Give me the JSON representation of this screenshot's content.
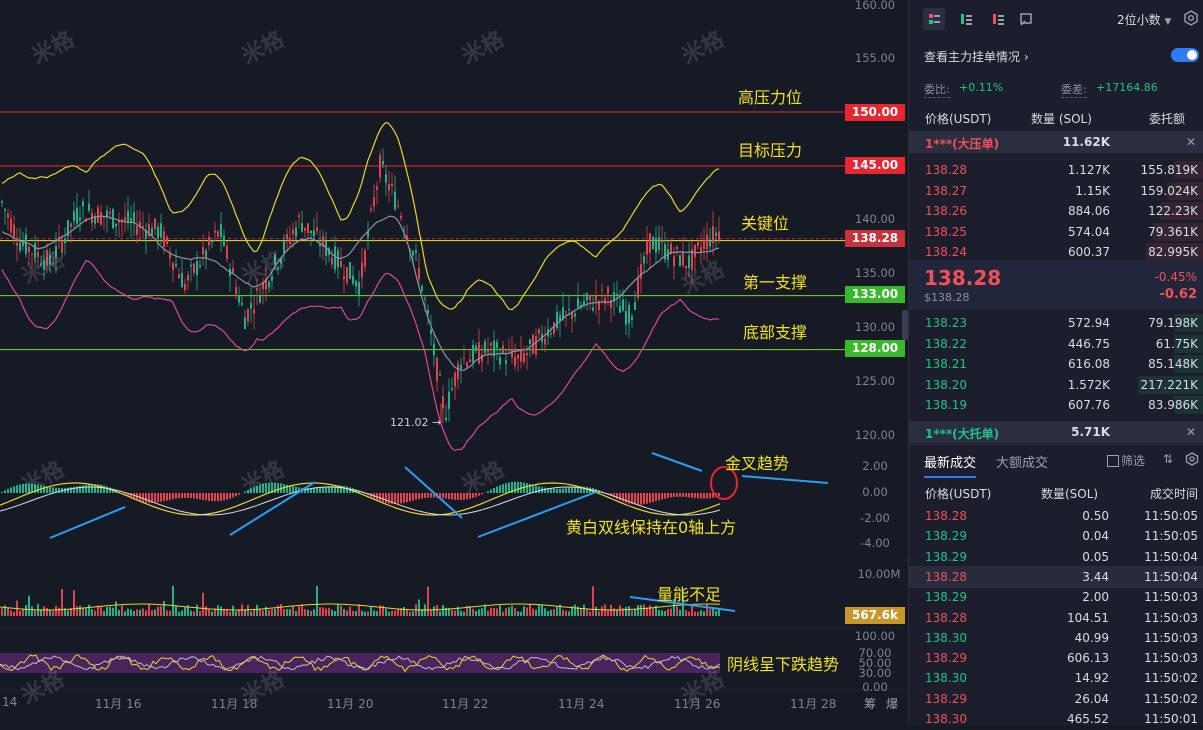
{
  "chart": {
    "y_axis_labels": [
      "160.00",
      "155.00",
      "150.00",
      "145.00",
      "140.00",
      "135.00",
      "130.00",
      "125.00",
      "120.00"
    ],
    "price_tags": [
      {
        "label": "150.00",
        "color": "#e8262f"
      },
      {
        "label": "145.00",
        "color": "#e8262f"
      },
      {
        "label": "138.28",
        "color": "#c8303c"
      },
      {
        "label": "133.00",
        "color": "#39b82b"
      },
      {
        "label": "128.00",
        "color": "#39b82b"
      }
    ],
    "low_label": "121.02 →",
    "annotations": {
      "high_pressure": "高压力位",
      "target_pressure": "目标压力",
      "key_level": "关键位",
      "first_support": "第一支撑",
      "bottom_support": "底部支撑",
      "golden_cross": "金叉趋势",
      "lines_above_zero": "黄白双线保持在0轴上方",
      "volume_low": "量能不足",
      "bearish_trend": "阴线呈下跌趋势"
    },
    "macd_axis": [
      "2.00",
      "0.00",
      "-2.00",
      "-4.00"
    ],
    "volume_axis": [
      "10.00M"
    ],
    "volume_tag": "567.6k",
    "rsi_axis": [
      "100.00",
      "70.00",
      "50.00",
      "30.00",
      "0.00"
    ],
    "dates": [
      "14",
      "11月 16",
      "11月 18",
      "11月 20",
      "11月 22",
      "11月 24",
      "11月 26",
      "11月 28"
    ],
    "bottom_buttons": [
      "筹",
      "爆"
    ],
    "watermark": "米格"
  },
  "orderbook": {
    "decimals": "2位小数",
    "view_main_orders": "查看主力挂单情况",
    "bid_ratio_label": "委比:",
    "bid_ratio_value": "+0.11%",
    "bid_diff_label": "委差:",
    "bid_diff_value": "+17164.86",
    "col_price": "价格(USDT)",
    "col_qty": "数量 (SOL)",
    "col_amount": "委托额",
    "big_ask_label": "1***(大压单)",
    "big_ask_value": "11.62K",
    "asks": [
      {
        "price": "138.28",
        "qty": "1.127K",
        "amount": "155.819K"
      },
      {
        "price": "138.27",
        "qty": "1.15K",
        "amount": "159.024K"
      },
      {
        "price": "138.26",
        "qty": "884.06",
        "amount": "122.23K"
      },
      {
        "price": "138.25",
        "qty": "574.04",
        "amount": "79.361K"
      },
      {
        "price": "138.24",
        "qty": "600.37",
        "amount": "82.995K"
      }
    ],
    "last_price": "138.28",
    "last_price_sub": "$138.28",
    "change_pct": "-0.45%",
    "change_abs": "-0.62",
    "bids": [
      {
        "price": "138.23",
        "qty": "572.94",
        "amount": "79.198K"
      },
      {
        "price": "138.22",
        "qty": "446.75",
        "amount": "61.75K"
      },
      {
        "price": "138.21",
        "qty": "616.08",
        "amount": "85.148K"
      },
      {
        "price": "138.20",
        "qty": "1.572K",
        "amount": "217.221K"
      },
      {
        "price": "138.19",
        "qty": "607.76",
        "amount": "83.986K"
      }
    ],
    "big_bid_label": "1***(大托单)",
    "big_bid_value": "5.71K"
  },
  "trades": {
    "tab_latest": "最新成交",
    "tab_large": "大额成交",
    "checkbox_label": "筛选",
    "col_price": "价格(USDT)",
    "col_qty": "数量(SOL)",
    "col_time": "成交时间",
    "rows": [
      {
        "price": "138.28",
        "qty": "0.50",
        "time": "11:50:05",
        "side": "sell"
      },
      {
        "price": "138.29",
        "qty": "0.04",
        "time": "11:50:05",
        "side": "buy"
      },
      {
        "price": "138.29",
        "qty": "0.05",
        "time": "11:50:04",
        "side": "buy"
      },
      {
        "price": "138.28",
        "qty": "3.44",
        "time": "11:50:04",
        "side": "sell"
      },
      {
        "price": "138.29",
        "qty": "2.00",
        "time": "11:50:03",
        "side": "buy"
      },
      {
        "price": "138.28",
        "qty": "104.51",
        "time": "11:50:03",
        "side": "sell"
      },
      {
        "price": "138.30",
        "qty": "40.99",
        "time": "11:50:03",
        "side": "buy"
      },
      {
        "price": "138.29",
        "qty": "606.13",
        "time": "11:50:03",
        "side": "sell"
      },
      {
        "price": "138.30",
        "qty": "14.92",
        "time": "11:50:02",
        "side": "buy"
      },
      {
        "price": "138.29",
        "qty": "26.04",
        "time": "11:50:02",
        "side": "sell"
      },
      {
        "price": "138.30",
        "qty": "465.52",
        "time": "11:50:01",
        "side": "sell"
      }
    ]
  }
}
